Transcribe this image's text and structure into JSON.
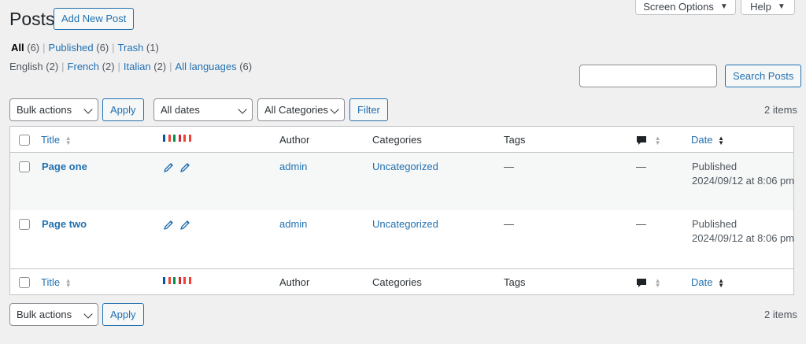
{
  "top_tabs": {
    "screen_options": "Screen Options",
    "help": "Help"
  },
  "page": {
    "title": "Posts",
    "add_new": "Add New Post"
  },
  "status_filters": [
    {
      "label": "All",
      "count": "(6)"
    },
    {
      "label": "Published",
      "count": "(6)"
    },
    {
      "label": "Trash",
      "count": "(1)"
    }
  ],
  "language_filters": [
    {
      "label": "English",
      "count": "(2)"
    },
    {
      "label": "French",
      "count": "(2)"
    },
    {
      "label": "Italian",
      "count": "(2)"
    },
    {
      "label": "All languages",
      "count": "(6)"
    }
  ],
  "search": {
    "value": "",
    "button": "Search Posts"
  },
  "top_nav": {
    "bulk_actions": "Bulk actions",
    "apply": "Apply",
    "dates": "All dates",
    "categories": "All Categories",
    "filter": "Filter",
    "items": "2 items"
  },
  "bottom_nav": {
    "bulk_actions": "Bulk actions",
    "apply": "Apply",
    "items": "2 items"
  },
  "columns": {
    "title": "Title",
    "author": "Author",
    "categories": "Categories",
    "tags": "Tags",
    "date": "Date"
  },
  "flag_colors": {
    "fr": [
      "#0055a4",
      "#ffffff",
      "#ef4135"
    ],
    "it": [
      "#009246",
      "#ffffff",
      "#ce2b37"
    ]
  },
  "rows": [
    {
      "title": "Page one",
      "author": "admin",
      "categories": "Uncategorized",
      "tags": "—",
      "comments": "—",
      "status": "Published",
      "date": "2024/09/12 at 8:06 pm"
    },
    {
      "title": "Page two",
      "author": "admin",
      "categories": "Uncategorized",
      "tags": "—",
      "comments": "—",
      "status": "Published",
      "date": "2024/09/12 at 8:06 pm"
    }
  ],
  "colors": {
    "accent": "#2271b1",
    "background": "#f0f0f1"
  }
}
